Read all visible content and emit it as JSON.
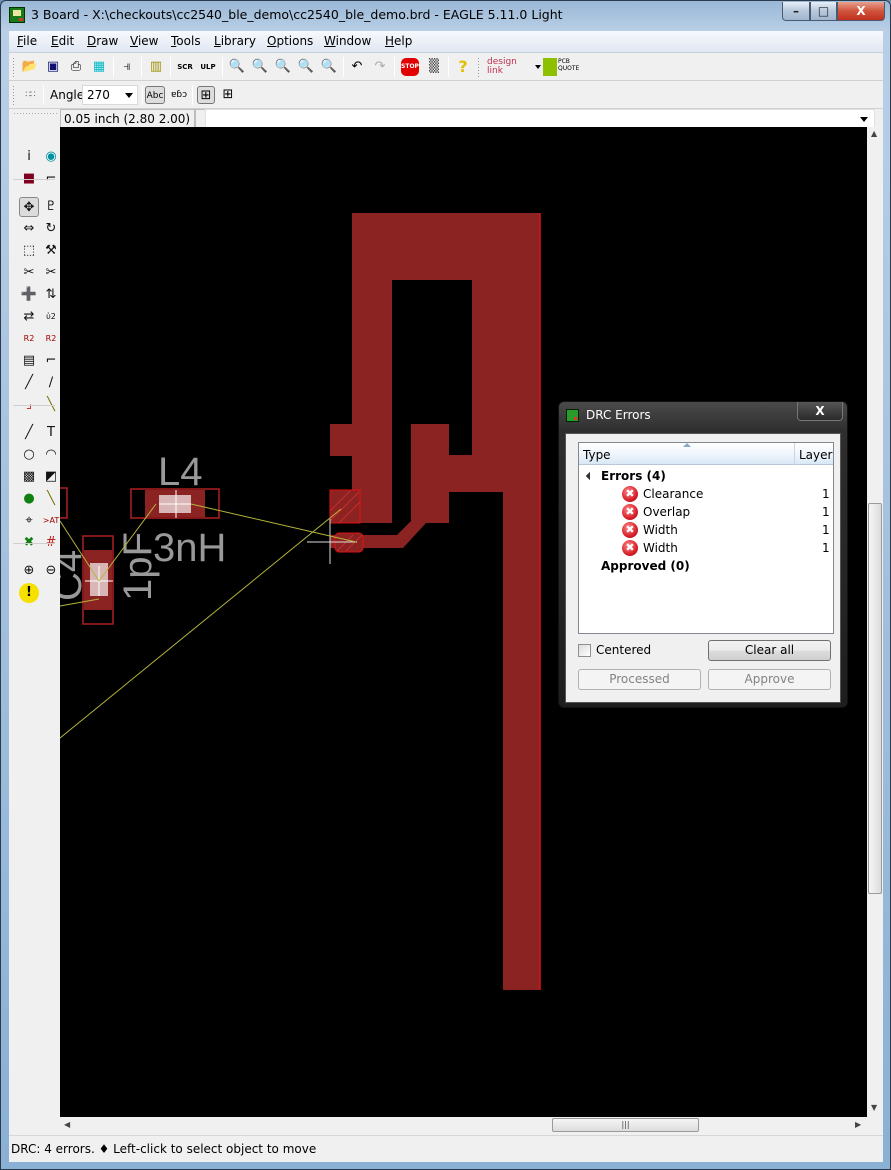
{
  "window": {
    "title": "3 Board - X:\\checkouts\\cc2540_ble_demo\\cc2540_ble_demo.brd - EAGLE 5.11.0 Light",
    "minimize_label": "–",
    "maximize_label": "□",
    "close_label": "X"
  },
  "menu": [
    {
      "label": "File",
      "accel": "F",
      "rest": "ile"
    },
    {
      "label": "Edit",
      "accel": "E",
      "rest": "dit"
    },
    {
      "label": "Draw",
      "accel": "D",
      "rest": "raw"
    },
    {
      "label": "View",
      "accel": "V",
      "rest": "iew"
    },
    {
      "label": "Tools",
      "accel": "T",
      "rest": "ools"
    },
    {
      "label": "Library",
      "accel": "L",
      "rest": "ibrary"
    },
    {
      "label": "Options",
      "accel": "O",
      "rest": "ptions"
    },
    {
      "label": "Window",
      "accel": "W",
      "rest": "indow"
    },
    {
      "label": "Help",
      "accel": "H",
      "rest": "elp"
    }
  ],
  "toolbar": {
    "icons": [
      "open-icon",
      "save-icon",
      "print-icon",
      "cam-processor-icon",
      "schematic-board-switch-icon",
      "library-icon",
      "script-icon",
      "ulp-icon",
      "zoom-fit-icon",
      "zoom-in-icon",
      "zoom-out-icon",
      "redraw-icon",
      "zoom-select-icon",
      "undo-icon",
      "redo-icon",
      "stop-icon",
      "go-icon",
      "help-icon"
    ],
    "designlink_label": "design link",
    "pcb_quote_label": "PCB QUOTE"
  },
  "params_bar": {
    "angle_label": "Angle:",
    "angle_value": "270",
    "text_abc": "Abc",
    "text_mirror": "ɐɓɔ"
  },
  "coords": {
    "readout": "0.05 inch (2.80 2.00)",
    "command_value": ""
  },
  "sidebar_tools": [
    "info",
    "show",
    "display",
    "mark",
    "move",
    "copy",
    "mirror",
    "rotate",
    "group",
    "change",
    "paste",
    "delete",
    "add",
    "pinswap",
    "replace",
    "lock",
    "smash",
    "value",
    "name",
    "miter",
    "split",
    "optimize",
    "route",
    "ripup",
    "wire",
    "text",
    "circle",
    "arc",
    "rect",
    "polygon",
    "via",
    "signal",
    "hole",
    "attribute",
    "ratsnest",
    "auto",
    "erc",
    "drc",
    "errors"
  ],
  "board": {
    "labels": {
      "l4": "L4",
      "l4_value": "3nH",
      "cap_value": "1pF",
      "left_label": "C4"
    },
    "copper_color": "#8b2323",
    "highlight_color": "#e01010",
    "airwire_color": "#b5b53c"
  },
  "drc_dialog": {
    "title": "DRC Errors",
    "close_label": "X",
    "columns": {
      "type": "Type",
      "layer": "Layer"
    },
    "errors_group": "Errors (4)",
    "errors": [
      {
        "type": "Clearance",
        "layer": "1"
      },
      {
        "type": "Overlap",
        "layer": "1"
      },
      {
        "type": "Width",
        "layer": "1"
      },
      {
        "type": "Width",
        "layer": "1"
      }
    ],
    "approved_group": "Approved (0)",
    "centered_label": "Centered",
    "centered_checked": false,
    "clear_all_label": "Clear all",
    "processed_label": "Processed",
    "approve_label": "Approve"
  },
  "status": {
    "text": "DRC: 4 errors.  ♦ Left-click to select object to move"
  }
}
